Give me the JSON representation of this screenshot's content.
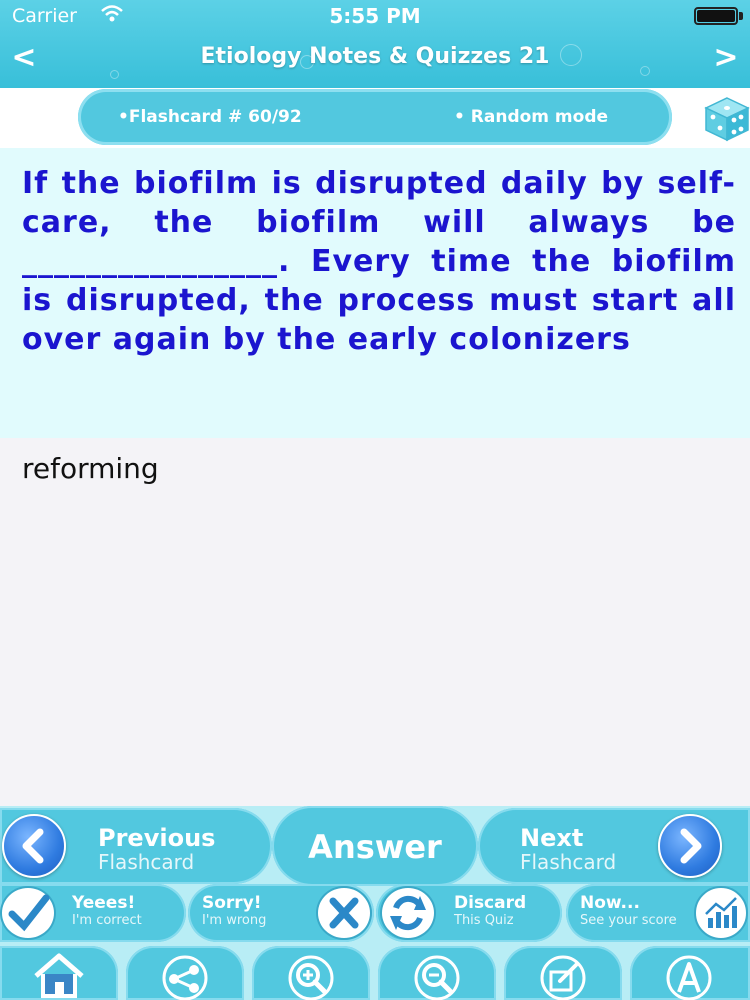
{
  "status_bar": {
    "carrier": "Carrier",
    "time": "5:55 PM"
  },
  "nav": {
    "back_glyph": "<",
    "title": "Etiology Notes & Quizzes 21",
    "forward_glyph": ">"
  },
  "info": {
    "flashcard_label": "•Flashcard #  60/92",
    "mode_label": "• Random mode",
    "dice_icon": "dice-icon"
  },
  "question": "If the biofilm is disrupted daily by self-care, the biofilm will always be ________________. Every time the biofilm is disrupted, the process must start all over again by the early colonizers",
  "answer": "reforming",
  "controls": {
    "previous": {
      "title": "Previous",
      "subtitle": "Flashcard"
    },
    "answer_label": "Answer",
    "next": {
      "title": "Next",
      "subtitle": "Flashcard"
    }
  },
  "feedback": {
    "correct": {
      "title": "Yeees!",
      "subtitle": "I'm correct"
    },
    "wrong": {
      "title": "Sorry!",
      "subtitle": "I'm wrong"
    },
    "discard": {
      "title": "Discard",
      "subtitle": "This Quiz"
    },
    "score": {
      "title": "Now...",
      "subtitle": "See your score"
    }
  },
  "toolbar": [
    "home-icon",
    "share-icon",
    "zoom-in-icon",
    "zoom-out-icon",
    "edit-icon",
    "font-icon"
  ],
  "colors": {
    "accent": "#52c8df",
    "question_text": "#1b15cf",
    "question_bg": "#e1fbfd"
  }
}
